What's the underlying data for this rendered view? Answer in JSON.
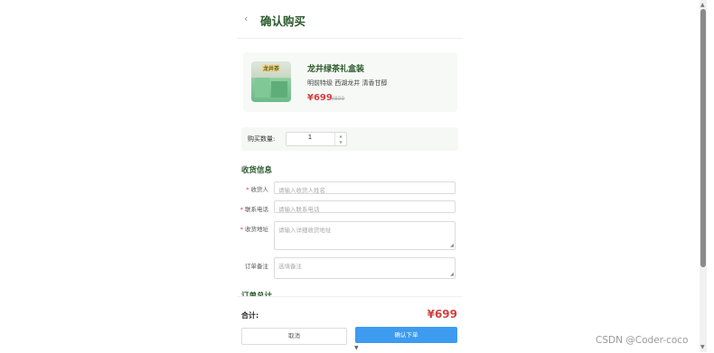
{
  "header": {
    "back_icon": "chevron-left-icon",
    "back_glyph": "‹",
    "title": "确认购买"
  },
  "product": {
    "image_icon": "tea-gift-box-image",
    "image_tag": "龙井茶",
    "name": "龙井绿茶礼盒装",
    "description": "明前特级 西湖龙井 清香甘醇",
    "price": "¥699",
    "original_price": "¥899"
  },
  "quantity": {
    "label": "购买数量:",
    "value": "1",
    "up_icon": "caret-up-icon",
    "down_icon": "caret-down-icon"
  },
  "shipping": {
    "title": "收货信息",
    "required_mark": "*",
    "receiver_label": "收货人",
    "receiver_placeholder": "请输入收货人姓名",
    "phone_label": "联系电话",
    "phone_placeholder": "请输入联系电话",
    "address_label": "收货地址",
    "address_placeholder": "请输入详细收货地址",
    "remark_label": "订单备注",
    "remark_placeholder": "选填备注"
  },
  "summary": {
    "title_partial": "订单总计"
  },
  "footer": {
    "total_label": "合计:",
    "total_amount": "¥699",
    "cancel_label": "取消",
    "confirm_label": "确认下单"
  },
  "watermark": "CSDN @Coder-coco",
  "colors": {
    "accent_green": "#2c5a2c",
    "price_red": "#d23f3f",
    "primary_blue": "#3d9bf0"
  }
}
